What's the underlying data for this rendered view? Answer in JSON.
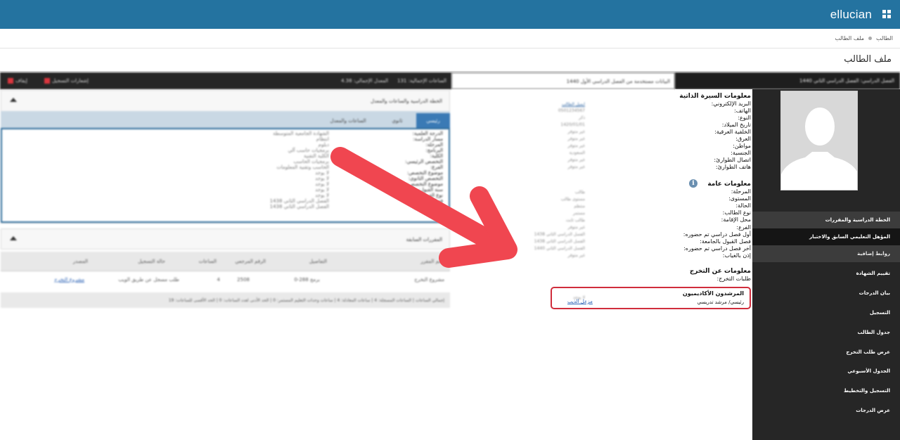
{
  "header": {
    "brand": "ellucian",
    "brand_mark": ".",
    "apps_icon": "grid-icon"
  },
  "breadcrumb": {
    "items": [
      "الطالب",
      "ملف الطالب"
    ]
  },
  "page": {
    "title": "ملف الطالب"
  },
  "info_panel": {
    "bio_heading": "معلومات السيرة الذاتية",
    "bio_fields": [
      "البريد الإلكتروني:",
      "الهاتف:",
      "النوع:",
      "تاريخ الميلاد:",
      "الخلفية العرقية:",
      "العرق:",
      "مواطن:",
      "الجنسية:",
      "اتصال الطوارئ:",
      "هاتف الطوارئ:"
    ],
    "general_heading": "معلومات عامة",
    "general_fields": [
      "المرحلة:",
      "المستوى:",
      "الحالة:",
      "نوع الطالب:",
      "محل الإقامة:",
      "الفرع:",
      "أول فصل دراسي تم حضوره:",
      "فصل القبول بالجامعة:",
      "آخر فصل دراسي تم حضوره:",
      "إذن بالغياب:"
    ],
    "grad_heading": "معلومات عن التخرج",
    "grad_fields": [
      "طلبات التخرج:"
    ],
    "advisors_heading": "المرشدون الأكاديميون",
    "advisor_role": "رئيسي/ مرشد تدريسي",
    "advisor_link": "مزعل الذيب"
  },
  "sidebar": {
    "items": [
      {
        "label": "الخطة الدراسية والمقررات"
      },
      {
        "label": "المؤهل التعليمي السابق والاختبار"
      },
      {
        "label": "روابط إضافية"
      },
      {
        "label": "تقييم الشهادة"
      },
      {
        "label": "بيان الدرجات"
      },
      {
        "label": "التسجيل"
      },
      {
        "label": "جدول الطالب"
      },
      {
        "label": "عرض طلب التخرج"
      },
      {
        "label": "الجدول الأسبوعي"
      },
      {
        "label": "التسجيل والتخطيط"
      },
      {
        "label": "عرض الدرجات"
      }
    ]
  },
  "top_strips": {
    "right": "الفصل الدراسي: الفصل الدراسي الثاني 1440",
    "middle": "البيانات مستخدمة من الفصل الدراسي الأول 1440",
    "left_total_hours": "الساعات الإجمالية: 131",
    "left_gpa": "المعدل الإجمالي: 4.38",
    "left_holds": "إيقاف",
    "left_registration": "إشعارات التسجيل"
  },
  "blurred": {
    "curriculum_title": "الخطة الدراسية والساعات والمعدل",
    "tabs": [
      "رئيسي",
      "ثانوي",
      "الساعات والمعدل"
    ],
    "curriculum_labels": [
      "الدرجة العلمية:",
      "مسار الدراسة:",
      "المرحلة:",
      "البرنامج:",
      "الكلية:",
      "التخصص الرئيسي:",
      "الفرع:",
      "موضوع التخصص:",
      "التخصص الثانوي:",
      "موضوع التخصص:",
      "سنة القبول:",
      "نوع القبول:",
      "فصل القبول:",
      "الفصل المقرر:"
    ],
    "curriculum_values": [
      "الشهادة الجامعية المتوسطة",
      "انتظام",
      "دبلوم",
      "برمجيات حاسب آلي",
      "الكلية التقنية",
      "برمجيات الحاسب",
      "الحاسب وتقنية المعلومات",
      "لا يوجد",
      "لا يوجد",
      "لا يوجد",
      "لا يوجد",
      "لا يوجد",
      "الفصل الدراسي الثاني 1438",
      "الفصل الدراسي الثاني 1438"
    ],
    "prior_courses_title": "المقررات السابقة",
    "table_headers": [
      "اسم المقرر",
      "التفاصيل",
      "الرقم المرجعي",
      "الساعات",
      "حالة التسجيل",
      "المصدر"
    ],
    "table_row": [
      "مشروع التخرج",
      "برمج 288-0",
      "2508",
      "4",
      "طلب مسجل عن طريق الويب",
      "مشروع التخرج"
    ],
    "summary": "إجمالي الساعات | الساعات المسجلة: 4 | ساعات المعادلة: 4 | ساعات وحدات التعليم المستمر: 0 | الحد الأدنى لعدد الساعات: 0 | الحد الأقصى للساعات: 19",
    "mid_values": [
      "ايميل الطالب",
      "0501234567",
      "ذكر",
      "1420/01/01",
      "غير متوفر",
      "غير متوفر",
      "غير متوفر",
      "السعودية",
      "غير متوفر",
      "غير متوفر",
      "طالب",
      "مستوى طالب",
      "منتظم",
      "مستمر",
      "طالب ثابت",
      "غير متوفر",
      "الفصل الدراسي الثاني 1438",
      "الفصل الدراسي الثاني 1438",
      "الفصل الدراسي الثاني 1440",
      "غير متوفر",
      "لا يوجد"
    ]
  },
  "colors": {
    "topbar": "#2473a0",
    "sidebar": "#262626",
    "highlight_border": "#d02d3c",
    "arrow": "#f04650"
  }
}
